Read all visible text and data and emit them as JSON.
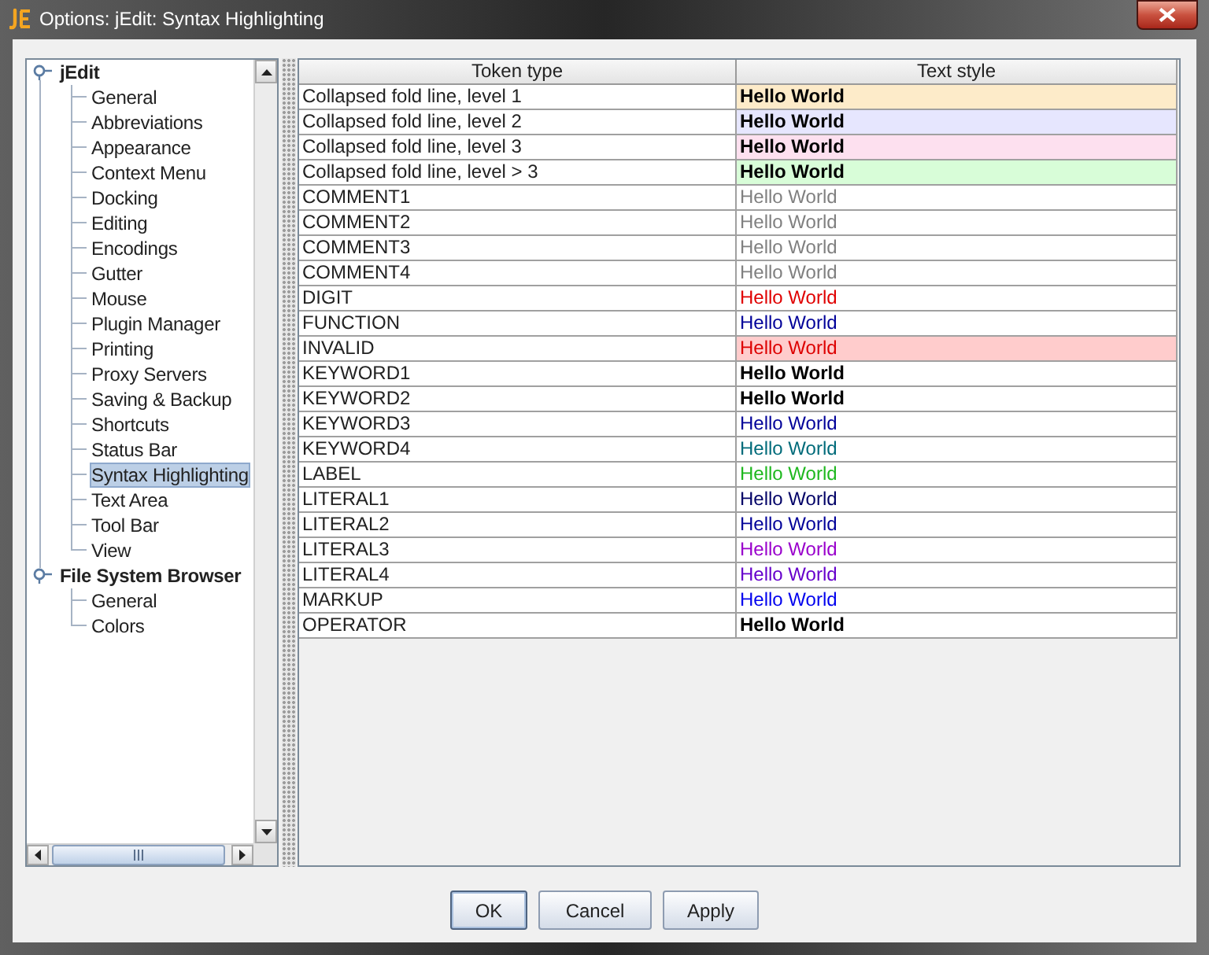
{
  "window": {
    "title": "Options: jEdit: Syntax Highlighting"
  },
  "tree": [
    {
      "label": "jEdit",
      "expanded": true,
      "selected": false,
      "children": [
        {
          "label": "General",
          "selected": false
        },
        {
          "label": "Abbreviations",
          "selected": false
        },
        {
          "label": "Appearance",
          "selected": false
        },
        {
          "label": "Context Menu",
          "selected": false
        },
        {
          "label": "Docking",
          "selected": false
        },
        {
          "label": "Editing",
          "selected": false
        },
        {
          "label": "Encodings",
          "selected": false
        },
        {
          "label": "Gutter",
          "selected": false
        },
        {
          "label": "Mouse",
          "selected": false
        },
        {
          "label": "Plugin Manager",
          "selected": false
        },
        {
          "label": "Printing",
          "selected": false
        },
        {
          "label": "Proxy Servers",
          "selected": false
        },
        {
          "label": "Saving & Backup",
          "selected": false
        },
        {
          "label": "Shortcuts",
          "selected": false
        },
        {
          "label": "Status Bar",
          "selected": false
        },
        {
          "label": "Syntax Highlighting",
          "selected": true
        },
        {
          "label": "Text Area",
          "selected": false
        },
        {
          "label": "Tool Bar",
          "selected": false
        },
        {
          "label": "View",
          "selected": false
        }
      ]
    },
    {
      "label": "File System Browser",
      "expanded": true,
      "selected": false,
      "children": [
        {
          "label": "General",
          "selected": false
        },
        {
          "label": "Colors",
          "selected": false
        }
      ]
    }
  ],
  "table": {
    "columns": [
      "Token type",
      "Text style"
    ],
    "rows": [
      {
        "token_type": "Collapsed fold line, level 1",
        "style": {
          "text": "Hello World",
          "bold": true,
          "color": "#000000",
          "highlight": {
            "color": "#fdebc9"
          }
        }
      },
      {
        "token_type": "Collapsed fold line, level 2",
        "style": {
          "text": "Hello World",
          "bold": true,
          "color": "#000000",
          "highlight": {
            "color": "#e6e6fe"
          }
        }
      },
      {
        "token_type": "Collapsed fold line, level 3",
        "style": {
          "text": "Hello World",
          "bold": true,
          "color": "#000000",
          "highlight": {
            "color": "#fde0ef"
          }
        }
      },
      {
        "token_type": "Collapsed fold line, level > 3",
        "style": {
          "text": "Hello World",
          "bold": true,
          "color": "#000000",
          "highlight": {
            "color": "#d8fdd8"
          }
        }
      },
      {
        "token_type": "COMMENT1",
        "style": {
          "text": "Hello World",
          "bold": false,
          "color": "#808080"
        }
      },
      {
        "token_type": "COMMENT2",
        "style": {
          "text": "Hello World",
          "bold": false,
          "color": "#808080"
        }
      },
      {
        "token_type": "COMMENT3",
        "style": {
          "text": "Hello World",
          "bold": false,
          "color": "#808080"
        }
      },
      {
        "token_type": "COMMENT4",
        "style": {
          "text": "Hello World",
          "bold": false,
          "color": "#808080"
        }
      },
      {
        "token_type": "DIGIT",
        "style": {
          "text": "Hello World",
          "bold": false,
          "color": "#e00000"
        }
      },
      {
        "token_type": "FUNCTION",
        "style": {
          "text": "Hello World",
          "bold": false,
          "color": "#000099"
        }
      },
      {
        "token_type": "INVALID",
        "style": {
          "text": "Hello World",
          "bold": false,
          "color": "#dd0000",
          "highlight": {
            "color": "#ffcccc"
          }
        }
      },
      {
        "token_type": "KEYWORD1",
        "style": {
          "text": "Hello World",
          "bold": true,
          "color": "#000000"
        }
      },
      {
        "token_type": "KEYWORD2",
        "style": {
          "text": "Hello World",
          "bold": true,
          "color": "#000000"
        }
      },
      {
        "token_type": "KEYWORD3",
        "style": {
          "text": "Hello World",
          "bold": false,
          "color": "#000099"
        }
      },
      {
        "token_type": "KEYWORD4",
        "style": {
          "text": "Hello World",
          "bold": false,
          "color": "#006b7a"
        }
      },
      {
        "token_type": "LABEL",
        "style": {
          "text": "Hello World",
          "bold": false,
          "color": "#1fb81f"
        }
      },
      {
        "token_type": "LITERAL1",
        "style": {
          "text": "Hello World",
          "bold": false,
          "color": "#000066"
        }
      },
      {
        "token_type": "LITERAL2",
        "style": {
          "text": "Hello World",
          "bold": false,
          "color": "#000099"
        }
      },
      {
        "token_type": "LITERAL3",
        "style": {
          "text": "Hello World",
          "bold": false,
          "color": "#9900cc"
        }
      },
      {
        "token_type": "LITERAL4",
        "style": {
          "text": "Hello World",
          "bold": false,
          "color": "#6600cc"
        }
      },
      {
        "token_type": "MARKUP",
        "style": {
          "text": "Hello World",
          "bold": false,
          "color": "#0000ee"
        }
      },
      {
        "token_type": "OPERATOR",
        "style": {
          "text": "Hello World",
          "bold": true,
          "color": "#000000"
        }
      }
    ]
  },
  "buttons": [
    {
      "label": "OK",
      "default": true
    },
    {
      "label": "Cancel",
      "default": false
    },
    {
      "label": "Apply",
      "default": false
    }
  ]
}
